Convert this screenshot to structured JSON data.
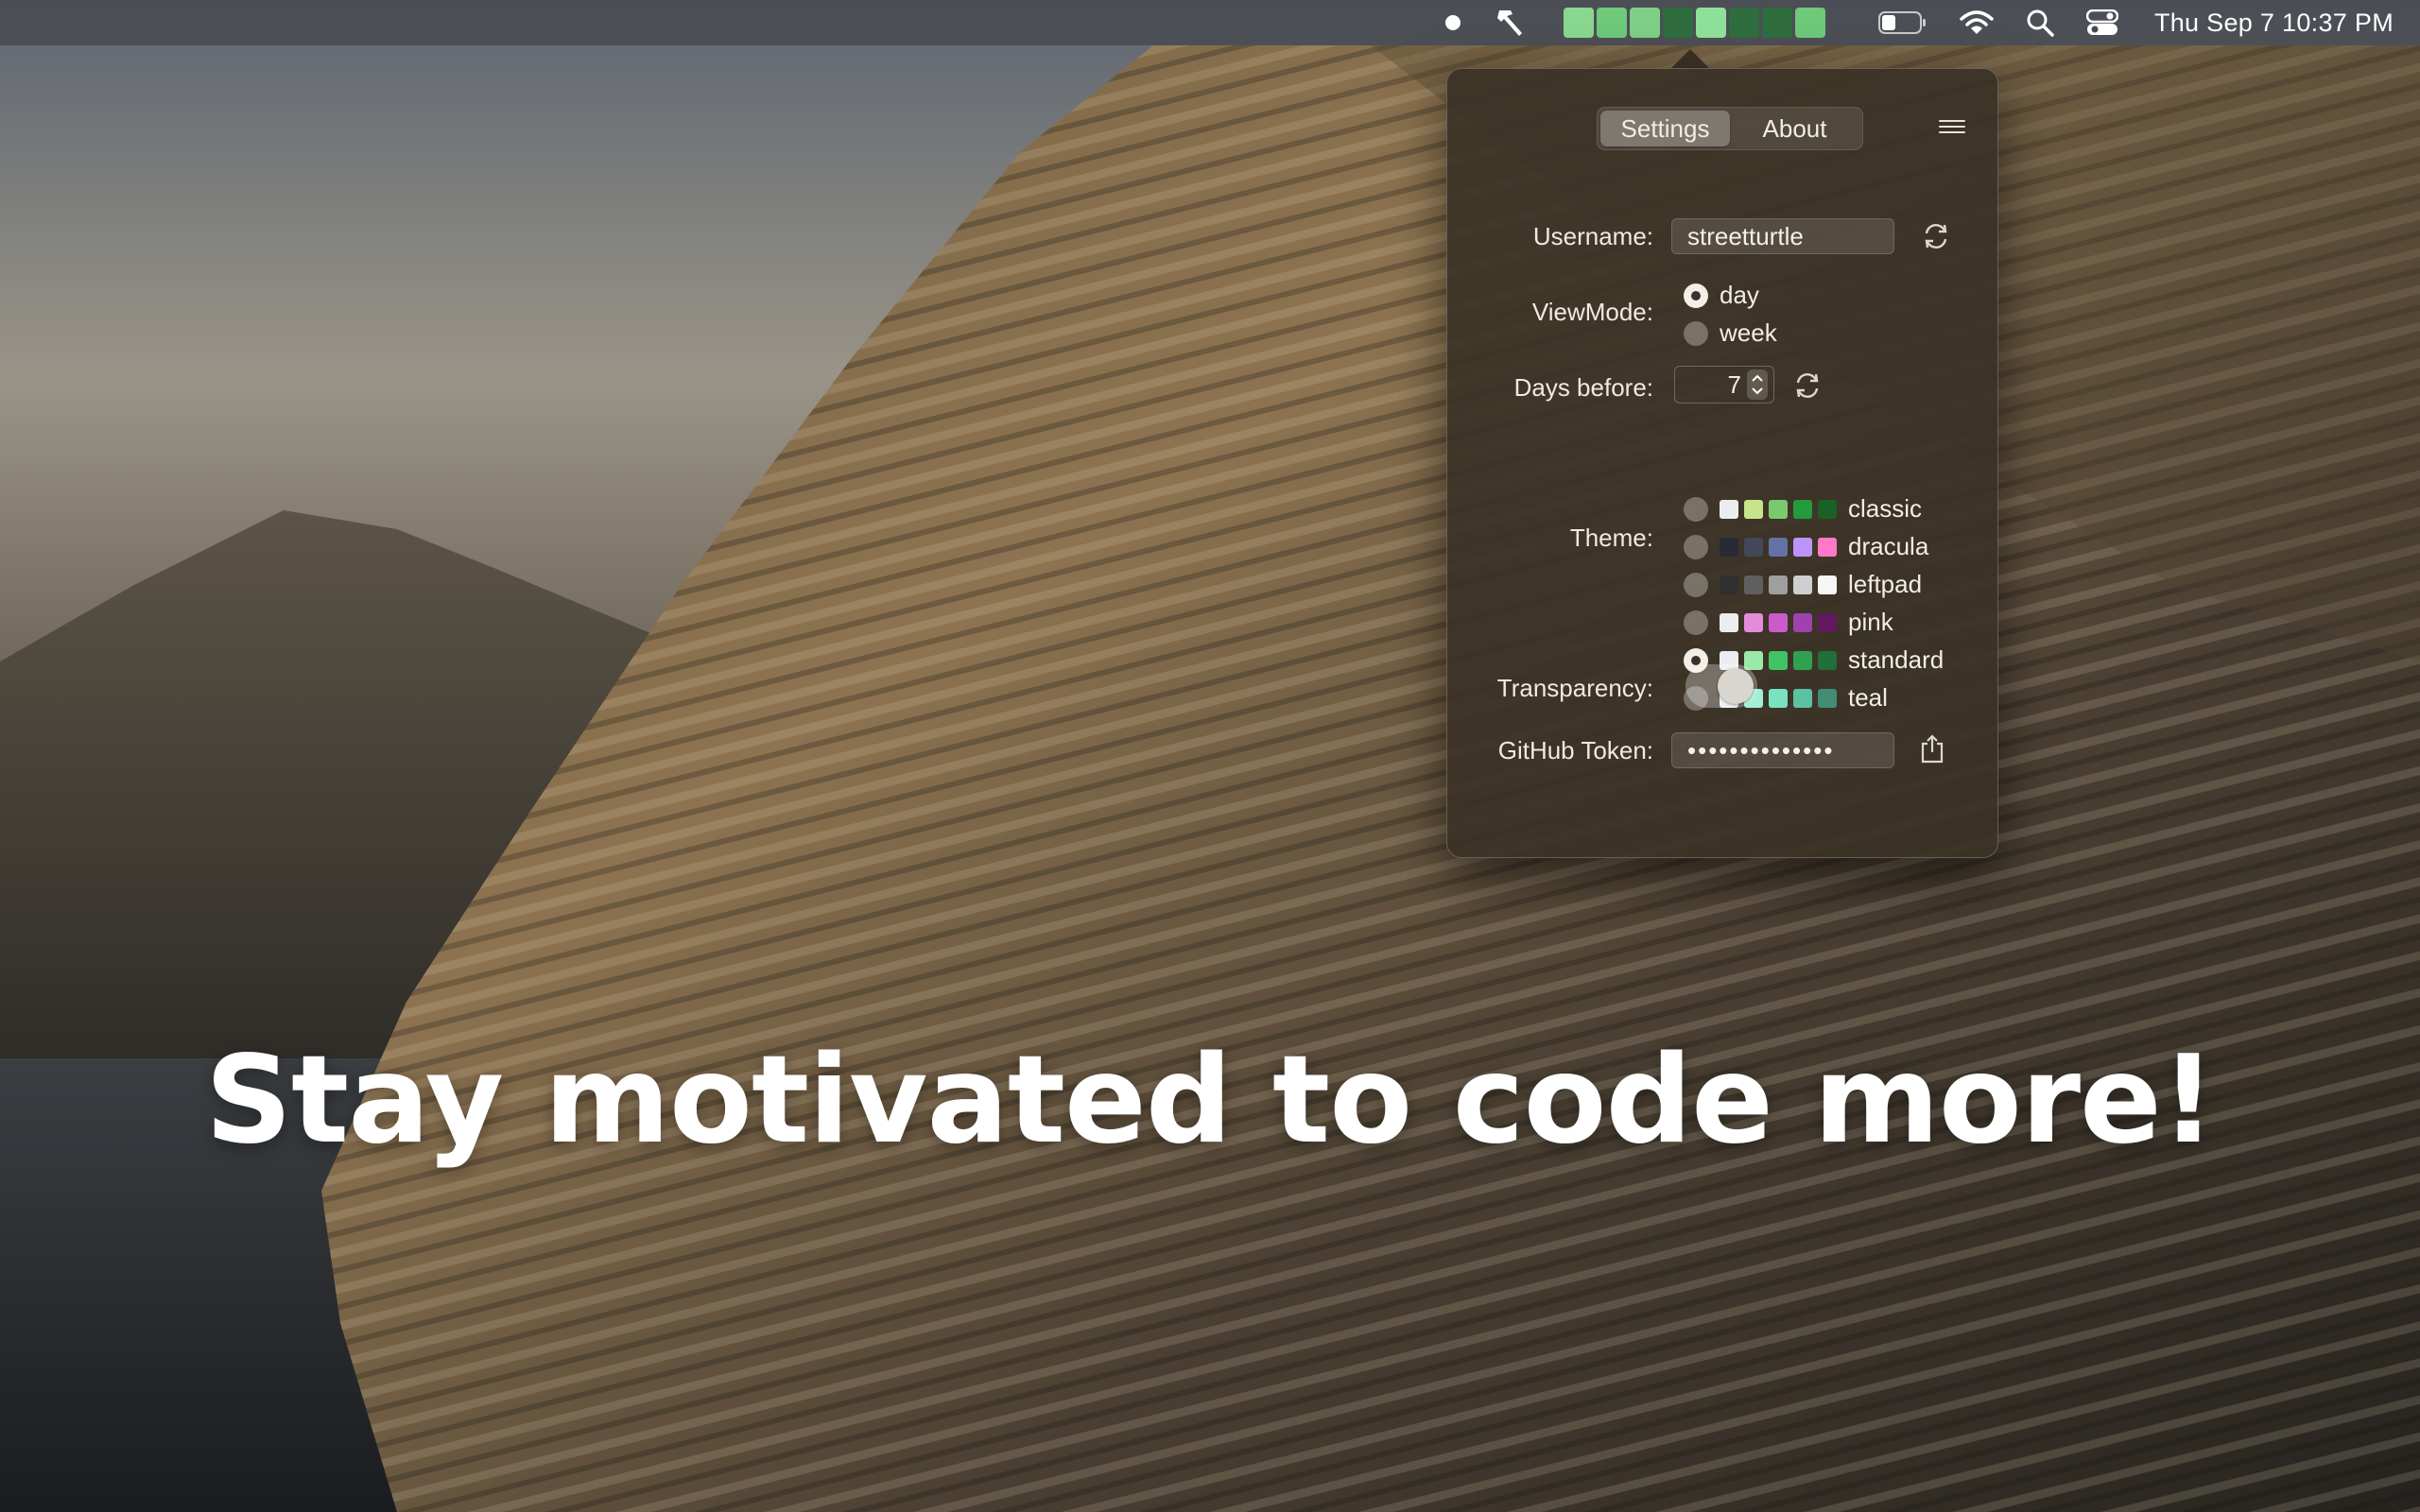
{
  "menubar": {
    "clock": "Thu Sep 7  10:37 PM",
    "contribution_cells": [
      "#8ad78f",
      "#6ec979",
      "#7fd086",
      "#2f6d3f",
      "#8ee19a",
      "#2f6d3f",
      "#2f6d3f",
      "#6ec979"
    ],
    "icons": [
      "dot-icon",
      "hammer-icon",
      "contribution-graph",
      "battery-icon",
      "wifi-icon",
      "search-icon",
      "control-center-icon"
    ]
  },
  "popover": {
    "tabs": [
      {
        "label": "Settings",
        "active": true
      },
      {
        "label": "About",
        "active": false
      }
    ],
    "username": {
      "label": "Username:",
      "value": "streetturtle"
    },
    "viewmode": {
      "label": "ViewMode:",
      "options": [
        {
          "label": "day",
          "selected": true
        },
        {
          "label": "week",
          "selected": false
        }
      ]
    },
    "days_before": {
      "label": "Days before:",
      "value": "7"
    },
    "theme": {
      "label": "Theme:",
      "options": [
        {
          "name": "classic",
          "selected": false,
          "colors": [
            "#ebedf0",
            "#c6e48b",
            "#7bc96f",
            "#239a3b",
            "#196127"
          ]
        },
        {
          "name": "dracula",
          "selected": false,
          "colors": [
            "#282a36",
            "#44475a",
            "#6272a4",
            "#bd93f9",
            "#ff79c6"
          ]
        },
        {
          "name": "leftpad",
          "selected": false,
          "colors": [
            "#2f2f2f",
            "#5f5f5f",
            "#9f9f9f",
            "#cfcfcf",
            "#f6f6f6"
          ]
        },
        {
          "name": "pink",
          "selected": false,
          "colors": [
            "#ebedf0",
            "#e48bdc",
            "#ca5bcc",
            "#a041b0",
            "#61185f"
          ]
        },
        {
          "name": "standard",
          "selected": true,
          "colors": [
            "#ebedf0",
            "#9be9a8",
            "#40c463",
            "#30a14e",
            "#216e39"
          ]
        },
        {
          "name": "teal",
          "selected": false,
          "colors": [
            "#ebedf0",
            "#a0f0d5",
            "#77e3c0",
            "#5ac2a2",
            "#438c76"
          ]
        }
      ]
    },
    "transparency": {
      "label": "Transparency:",
      "on": true
    },
    "token": {
      "label": "GitHub Token:",
      "value": "••••••••••••••"
    }
  },
  "headline": "Stay motivated to code more!"
}
